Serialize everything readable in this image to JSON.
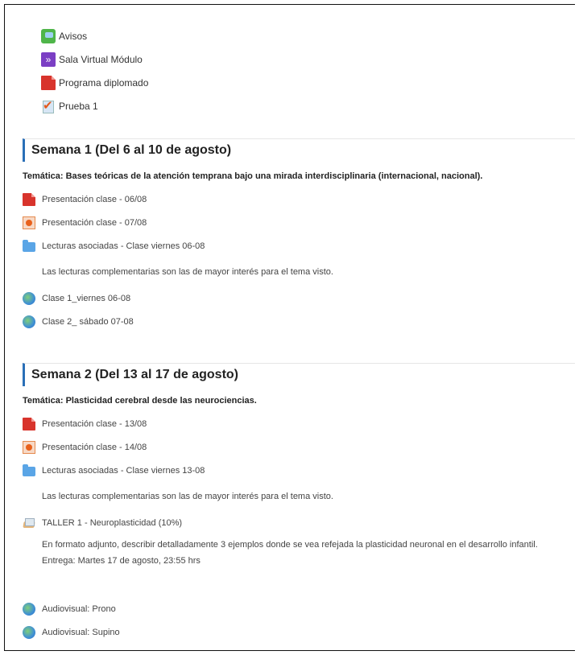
{
  "top_items": [
    {
      "label": "Avisos",
      "icon": "forum-icon"
    },
    {
      "label": "Sala Virtual Módulo",
      "icon": "virtual-room-icon"
    },
    {
      "label": "Programa diplomado",
      "icon": "pdf-icon"
    },
    {
      "label": "Prueba 1",
      "icon": "quiz-icon"
    }
  ],
  "week1": {
    "title": "Semana 1 (Del 6 al 10 de agosto)",
    "topic": "Temática: Bases teóricas de la atención temprana bajo una mirada interdisciplinaria (internacional, nacional).",
    "items": [
      "Presentación clase - 06/08",
      "Presentación clase - 07/08",
      "Lecturas asociadas - Clase viernes 06-08"
    ],
    "note": "Las lecturas complementarias son las de mayor interés para el tema visto.",
    "links": [
      "Clase 1_viernes 06-08",
      "Clase 2_ sábado 07-08"
    ]
  },
  "week2": {
    "title": "Semana 2 (Del 13 al 17 de agosto)",
    "topic": "Temática: Plasticidad cerebral desde las neurociencias.",
    "items": [
      "Presentación clase - 13/08",
      "Presentación clase - 14/08",
      "Lecturas asociadas - Clase viernes 13-08"
    ],
    "note": "Las lecturas complementarias son las de mayor interés para el tema visto.",
    "assignment": "TALLER 1 - Neuroplasticidad (10%)",
    "assignment_desc": "En formato adjunto, describir detalladamente 3 ejemplos donde se vea refejada la plasticidad neuronal en el desarrollo infantil.",
    "deadline": "Entrega: Martes 17 de agosto, 23:55 hrs",
    "links": [
      "Audiovisual: Prono",
      "Audiovisual: Supino"
    ]
  }
}
